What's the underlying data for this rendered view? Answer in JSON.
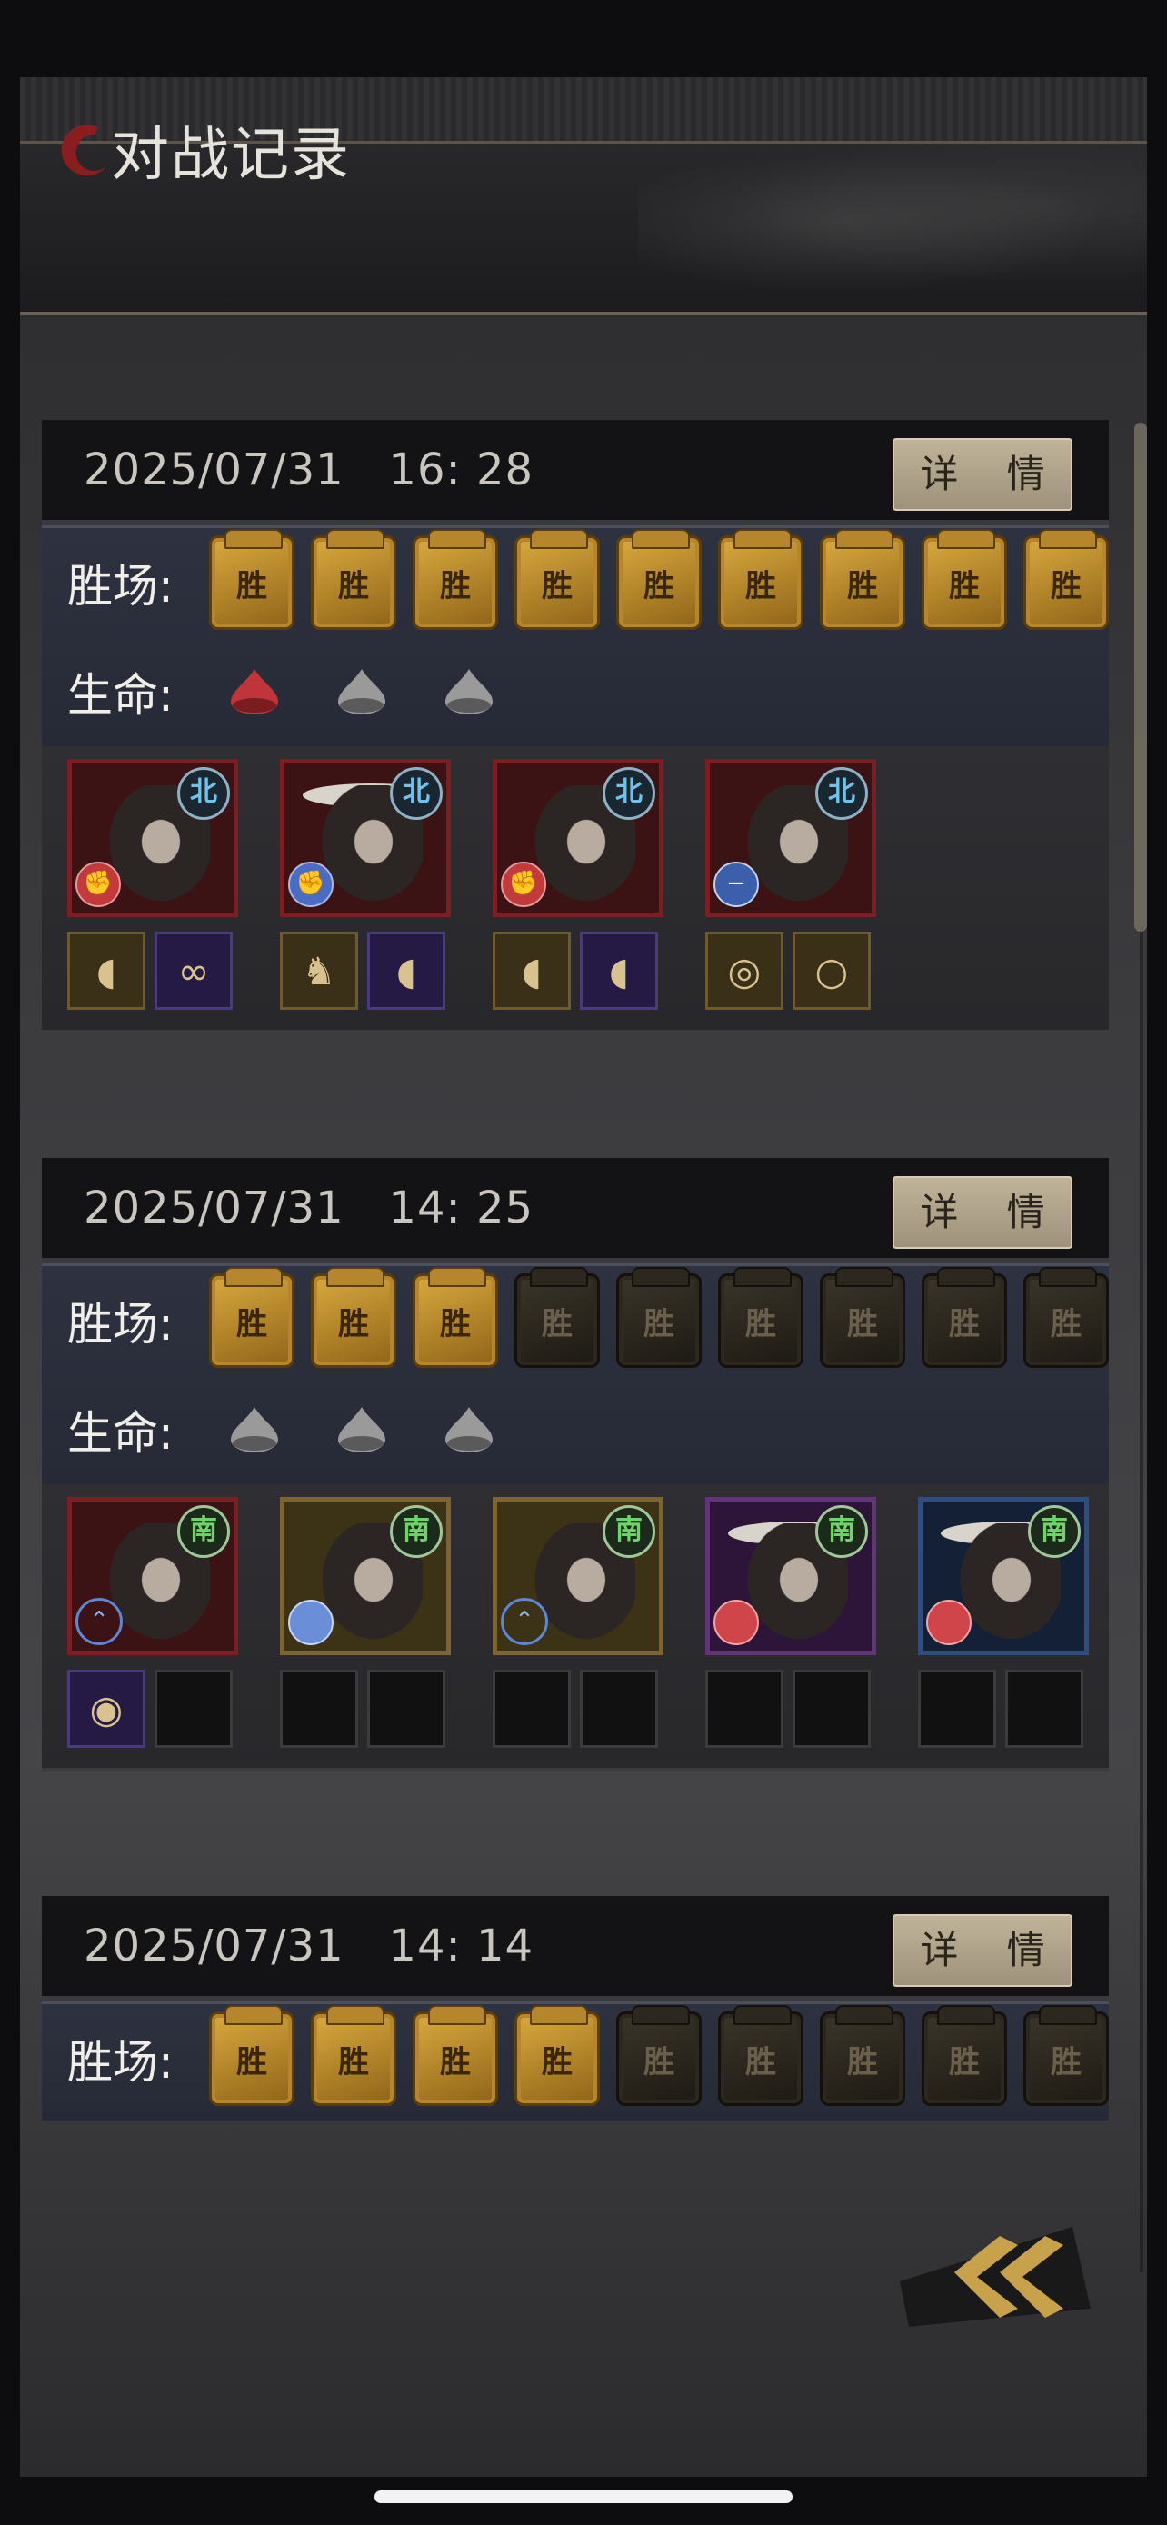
{
  "header": {
    "title": "对战记录"
  },
  "labels": {
    "wins": "胜场:",
    "lives": "生命:",
    "detail": "详 情",
    "token_char": "胜"
  },
  "records": [
    {
      "datetime": "2025/07/31   16: 28",
      "wins_on": 9,
      "wins_total": 9,
      "lives_on": 1,
      "lives_total": 3,
      "heroes": [
        {
          "camp": "北",
          "class": "fist-red",
          "items": [
            "gauntlet",
            "bracelet"
          ]
        },
        {
          "camp": "北",
          "class": "fist-blue",
          "items": [
            "alpaca",
            "gauntlet"
          ]
        },
        {
          "camp": "北",
          "class": "fist-red",
          "items": [
            "gauntlet",
            "gauntlet"
          ]
        },
        {
          "camp": "北",
          "class": "shield",
          "items": [
            "coin-necklace",
            "ring"
          ]
        }
      ]
    },
    {
      "datetime": "2025/07/31   14: 25",
      "wins_on": 3,
      "wins_total": 9,
      "lives_on": 0,
      "lives_total": 3,
      "heroes": [
        {
          "camp": "南",
          "class": "rank-up",
          "items": [
            "shell",
            "empty"
          ]
        },
        {
          "camp": "南",
          "class": "shield-blue",
          "items": [
            "empty",
            "empty"
          ]
        },
        {
          "camp": "南",
          "class": "rank-up",
          "items": [
            "empty",
            "empty"
          ]
        },
        {
          "camp": "南",
          "class": "shield-red",
          "items": [
            "empty",
            "empty"
          ]
        },
        {
          "camp": "南",
          "class": "shield-red",
          "items": [
            "empty",
            "empty"
          ]
        }
      ]
    },
    {
      "datetime": "2025/07/31   14: 14",
      "wins_on": 4,
      "wins_total": 9
    }
  ],
  "colors": {
    "accent_gold": "#c89a35",
    "life_red": "#c0353a",
    "life_gray": "#9a9a9a"
  }
}
